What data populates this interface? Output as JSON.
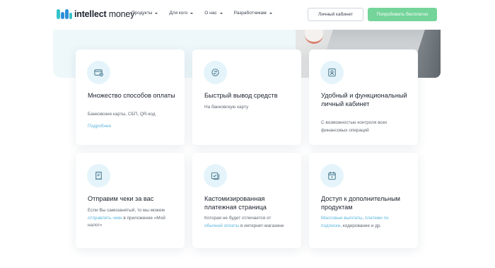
{
  "header": {
    "logo": {
      "brand": "intellect",
      "brand_suffix": "money"
    },
    "nav": [
      {
        "label": "Продукты"
      },
      {
        "label": "Для кого"
      },
      {
        "label": "О нас"
      },
      {
        "label": "Разработчикам"
      }
    ],
    "cabinet_button": "Личный кабинет",
    "try_button": "Попробовать бесплатно"
  },
  "colors": {
    "accent_green": "#74d49a",
    "link_blue": "#5cb6dc",
    "icon_bg": "#e4f4fa",
    "logo_blue": "#2f8fd8",
    "logo_teal": "#35c3c9"
  },
  "cards": [
    {
      "icon": "wallet-icon",
      "title": "Множество способов оплаты",
      "desc": "Банковские карты, СБП, QR-код",
      "more": "Подробнее"
    },
    {
      "icon": "transfer-icon",
      "title": "Быстрый вывод средств",
      "desc": "На банковскую карту"
    },
    {
      "icon": "cabinet-icon",
      "title": "Удобный и функциональный личный кабинет",
      "desc": "С возможностью контроля всех финансовых операций"
    },
    {
      "icon": "receipt-icon",
      "title": "Отправим чеки за вас",
      "desc_before": "Если Вы самозанятый, то мы можем ",
      "desc_link": "отправлять чеки",
      "desc_after": " в приложение «Мой налог»"
    },
    {
      "icon": "payment-page-icon",
      "title": "Кастомизированная платежная страница",
      "desc_before": "Которая не будет отличается от ",
      "desc_link": "обычной оплаты",
      "desc_after": " в интернет-магазине"
    },
    {
      "icon": "calendar-icon",
      "title": "Доступ к дополнительным продуктам",
      "desc_link": "Массовые выплаты",
      "desc_mid": ", ",
      "desc_link2": "платежи по подписке",
      "desc_after": ", кодирование и др."
    }
  ]
}
